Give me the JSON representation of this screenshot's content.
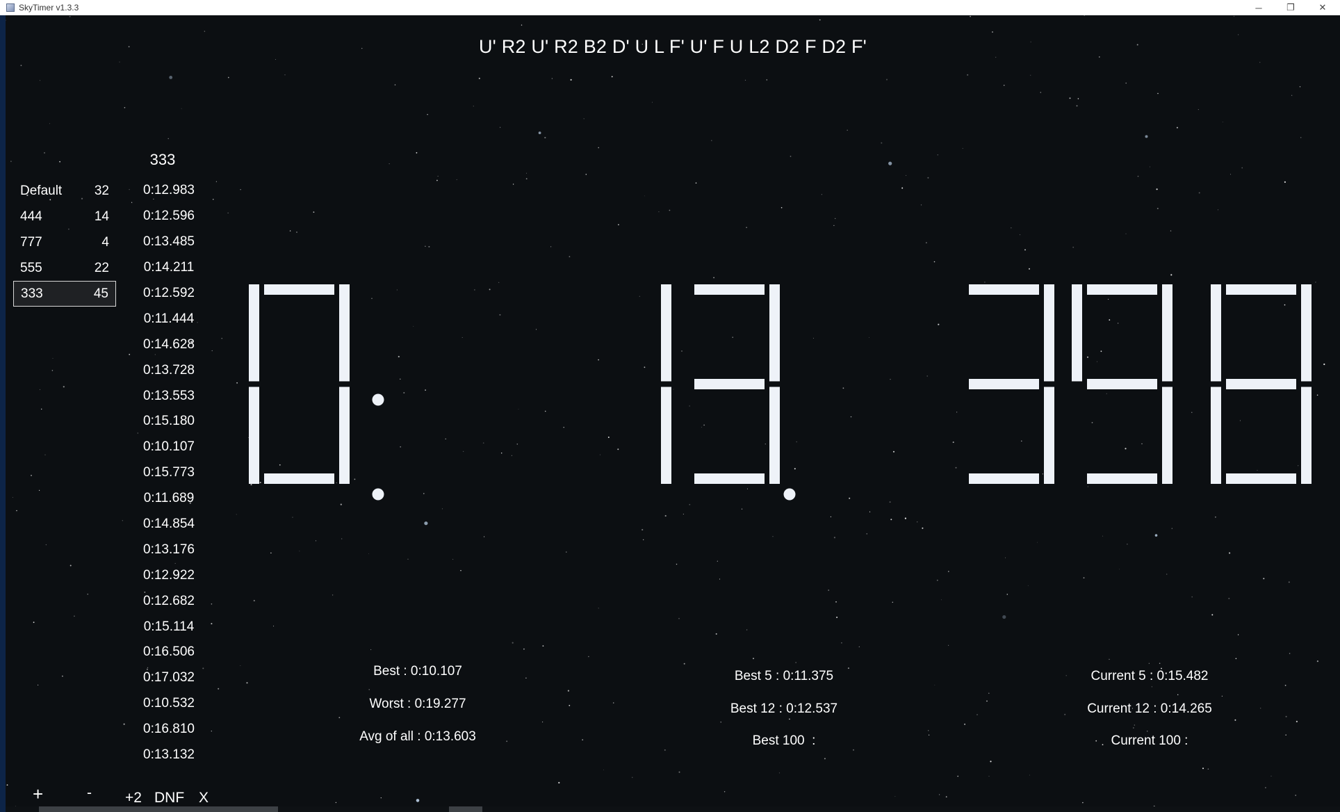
{
  "window": {
    "title": "SkyTimer v1.3.3",
    "minimize_glyph": "─",
    "restore_glyph": "❐",
    "close_glyph": "✕"
  },
  "scramble": "U' R2 U' R2 B2 D' U L F' U' F U L2 D2 F D2 F'",
  "sessions": [
    {
      "name": "Default",
      "count": "32",
      "selected": false
    },
    {
      "name": "444",
      "count": "14",
      "selected": false
    },
    {
      "name": "777",
      "count": "4",
      "selected": false
    },
    {
      "name": "555",
      "count": "22",
      "selected": false
    },
    {
      "name": "333",
      "count": "45",
      "selected": true
    }
  ],
  "times_header": "333",
  "times": [
    "0:12.983",
    "0:12.596",
    "0:13.485",
    "0:14.211",
    "0:12.592",
    "0:11.444",
    "0:14.628",
    "0:13.728",
    "0:13.553",
    "0:15.180",
    "0:10.107",
    "0:15.773",
    "0:11.689",
    "0:14.854",
    "0:13.176",
    "0:12.922",
    "0:12.682",
    "0:15.114",
    "0:16.506",
    "0:17.032",
    "0:10.532",
    "0:16.810",
    "0:13.132"
  ],
  "timer_display": "0:13.398",
  "stats": {
    "best": "Best : 0:10.107",
    "worst": "Worst : 0:19.277",
    "avg_all": "Avg of all : 0:13.603",
    "best5": "Best 5 : 0:11.375",
    "best12": "Best 12 : 0:12.537",
    "best100": "Best 100  :",
    "current5": "Current 5 : 0:15.482",
    "current12": "Current 12 : 0:14.265",
    "current100": "Current 100 :"
  },
  "controls": {
    "add": "+",
    "remove": "-",
    "plus2": "+2",
    "dnf": "DNF",
    "delete": "X"
  },
  "colors": {
    "background": "#0c0f12",
    "segment": "#eef2f8",
    "text": "#ffffff"
  }
}
